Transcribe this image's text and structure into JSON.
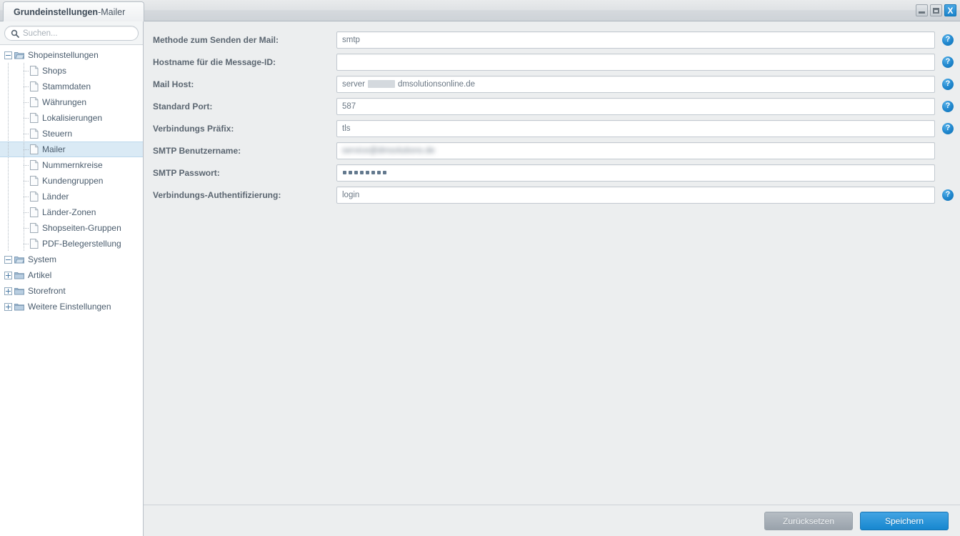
{
  "window": {
    "title_main": "Grundeinstellungen",
    "title_sep": " - ",
    "title_sub": "Mailer",
    "controls": {
      "minimize": "minimize-button",
      "maximize": "maximize-button",
      "close_label": "X"
    }
  },
  "sidebar": {
    "search_placeholder": "Suchen...",
    "search_value": "",
    "tree": [
      {
        "label": "Shopeinstellungen",
        "type": "folder-open",
        "level": 0,
        "toggle": "minus",
        "selected": false
      },
      {
        "label": "Shops",
        "type": "file",
        "level": 1,
        "toggle": "none",
        "selected": false
      },
      {
        "label": "Stammdaten",
        "type": "file",
        "level": 1,
        "toggle": "none",
        "selected": false
      },
      {
        "label": "Währungen",
        "type": "file",
        "level": 1,
        "toggle": "none",
        "selected": false
      },
      {
        "label": "Lokalisierungen",
        "type": "file",
        "level": 1,
        "toggle": "none",
        "selected": false
      },
      {
        "label": "Steuern",
        "type": "file",
        "level": 1,
        "toggle": "none",
        "selected": false
      },
      {
        "label": "Mailer",
        "type": "file",
        "level": 1,
        "toggle": "none",
        "selected": true
      },
      {
        "label": "Nummernkreise",
        "type": "file",
        "level": 1,
        "toggle": "none",
        "selected": false
      },
      {
        "label": "Kundengruppen",
        "type": "file",
        "level": 1,
        "toggle": "none",
        "selected": false
      },
      {
        "label": "Länder",
        "type": "file",
        "level": 1,
        "toggle": "none",
        "selected": false
      },
      {
        "label": "Länder-Zonen",
        "type": "file",
        "level": 1,
        "toggle": "none",
        "selected": false
      },
      {
        "label": "Shopseiten-Gruppen",
        "type": "file",
        "level": 1,
        "toggle": "none",
        "selected": false
      },
      {
        "label": "PDF-Belegerstellung",
        "type": "file",
        "level": 1,
        "toggle": "none",
        "selected": false
      },
      {
        "label": "System",
        "type": "folder-open",
        "level": 0,
        "toggle": "minus",
        "selected": false
      },
      {
        "label": "Artikel",
        "type": "folder",
        "level": 0,
        "toggle": "plus",
        "selected": false
      },
      {
        "label": "Storefront",
        "type": "folder",
        "level": 0,
        "toggle": "plus",
        "selected": false
      },
      {
        "label": "Weitere Einstellungen",
        "type": "folder",
        "level": 0,
        "toggle": "plus",
        "selected": false
      }
    ]
  },
  "form": {
    "rows": [
      {
        "label": "Methode zum Senden der Mail:",
        "value": "smtp",
        "kind": "text",
        "help": true
      },
      {
        "label": "Hostname für die Message-ID:",
        "value": "",
        "kind": "text",
        "help": true
      },
      {
        "label": "Mail Host:",
        "value_prefix": "server",
        "value_suffix": "dmsolutionsonline.de",
        "kind": "redacted",
        "help": true
      },
      {
        "label": "Standard Port:",
        "value": "587",
        "kind": "text",
        "help": true
      },
      {
        "label": "Verbindungs Präfix:",
        "value": "tls",
        "kind": "text",
        "help": true
      },
      {
        "label": "SMTP Benutzername:",
        "value": "service@dmsolutions.de",
        "kind": "blurred",
        "help": false
      },
      {
        "label": "SMTP Passwort:",
        "value": "",
        "kind": "password",
        "dots": 8,
        "help": false
      },
      {
        "label": "Verbindungs-Authentifizierung:",
        "value": "login",
        "kind": "text",
        "help": true
      }
    ]
  },
  "footer": {
    "reset_label": "Zurücksetzen",
    "save_label": "Speichern"
  },
  "colors": {
    "accent": "#1787cf",
    "help_blue": "#1f86cd",
    "selection": "#daeaf5",
    "label_text": "#5b6671"
  }
}
